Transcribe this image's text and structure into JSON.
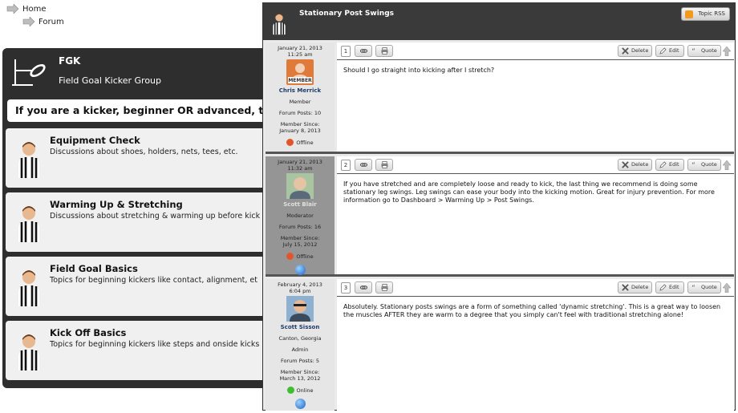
{
  "breadcrumb": {
    "home": "Home",
    "forum": "Forum"
  },
  "forum": {
    "name": "FGK",
    "description": "Field Goal Kicker Group",
    "banner": "If you are a kicker, beginner OR advanced, th",
    "categories": [
      {
        "title": "Equipment Check",
        "description": "Discussions about shoes, holders, nets, tees, etc."
      },
      {
        "title": "Warming Up & Stretching",
        "description": "Discussions about stretching & warming up before kick"
      },
      {
        "title": "Field Goal Basics",
        "description": "Topics for beginning kickers like contact, alignment, et"
      },
      {
        "title": "Kick Off Basics",
        "description": "Topics for beginning kickers like steps and onside kicks"
      }
    ]
  },
  "topic": {
    "title": "Stationary Post Swings",
    "rss_label": "Topic RSS",
    "actions": {
      "delete": "Delete",
      "edit": "Edit",
      "quote": "Quote"
    },
    "posts": [
      {
        "number": "1",
        "date": "January 21, 2013",
        "time": "11:25 am",
        "avatar_label": "MEMBER",
        "user": "Chris Merrick",
        "location": "",
        "role": "Member",
        "forum_posts": "Forum Posts: 10",
        "member_since_label": "Member Since:",
        "member_since": "January 8, 2013",
        "status": "Offline",
        "text": "Should I go straight into kicking after I stretch?"
      },
      {
        "number": "2",
        "date": "January 21, 2013",
        "time": "11:32 am",
        "user": "Scott Blair",
        "role": "Moderator",
        "forum_posts": "Forum Posts: 16",
        "member_since_label": "Member Since:",
        "member_since": "July 15, 2012",
        "status": "Offline",
        "text": "If you have stretched and are completely loose and ready to kick, the last thing we recommend is doing some stationary leg swings. Leg swings can ease your body into the kicking motion. Great for injury prevention. For more information go to Dashboard > Warming Up > Post Swings."
      },
      {
        "number": "3",
        "date": "February 4, 2013",
        "time": "6:04 pm",
        "user": "Scott Sisson",
        "location": "Canton, Georgia",
        "role": "Admin",
        "forum_posts": "Forum Posts: 5",
        "member_since_label": "Member Since:",
        "member_since": "March 13, 2012",
        "status": "Online",
        "text": "Absolutely. Stationary posts swings are a form of something called 'dynamic stretching'. This is a great way to loosen the muscles AFTER they are warm to a degree that you simply can't feel with traditional stretching alone!"
      }
    ]
  },
  "colors": {
    "panel_dark": "#2e2e2e",
    "online": "#3fbf2f",
    "offline": "#e2552a",
    "username_blue": "#1f3b6b"
  }
}
